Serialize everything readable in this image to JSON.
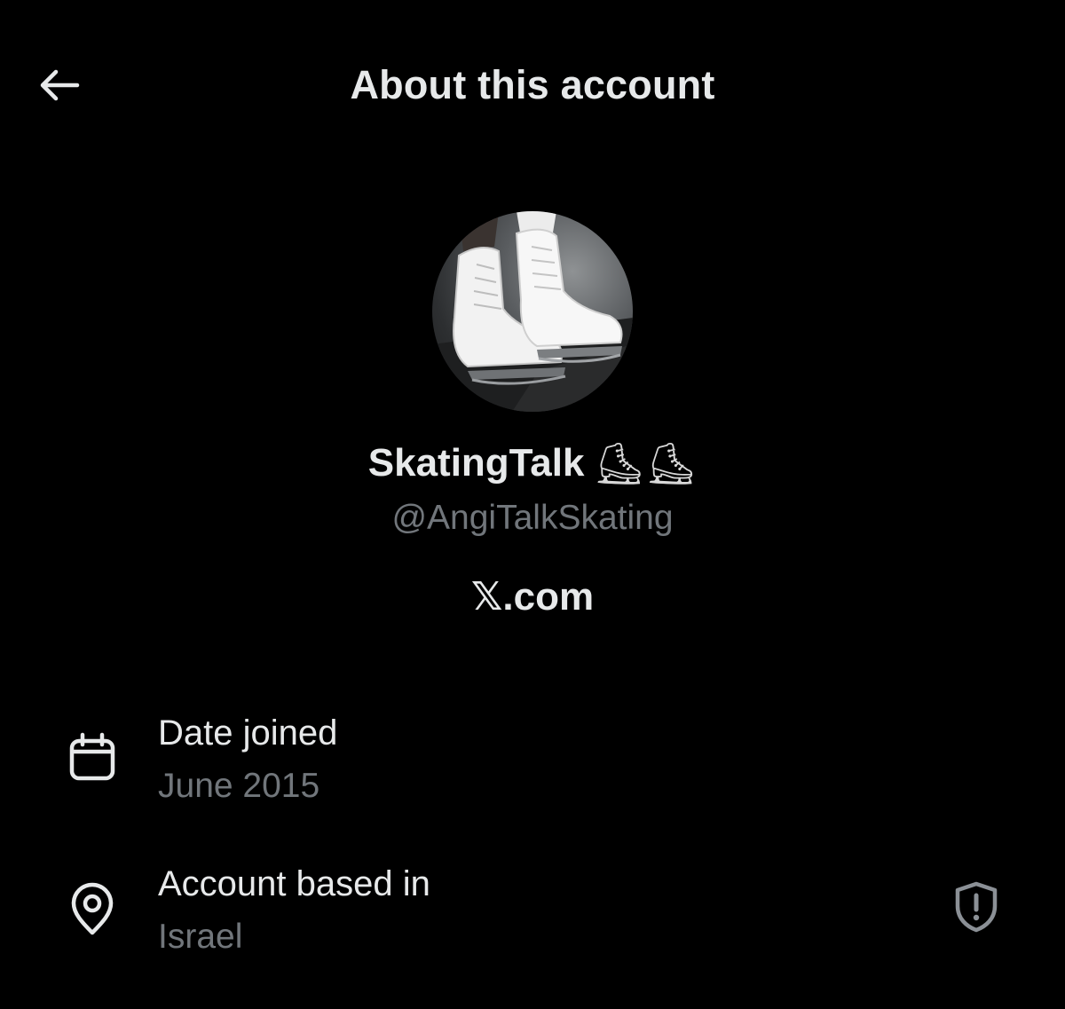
{
  "header": {
    "title": "About this account",
    "back_icon": "arrow-left-icon"
  },
  "profile": {
    "display_name": "SkatingTalk",
    "name_emoji": "⛸⛸",
    "handle": "@AngiTalkSkating",
    "source": "𝕏.com",
    "avatar_description_icon": "ice-skates-avatar"
  },
  "details": {
    "date_joined": {
      "icon": "calendar-icon",
      "label": "Date joined",
      "value": "June 2015"
    },
    "location": {
      "icon": "location-pin-icon",
      "label": "Account based in",
      "value": "Israel",
      "action_icon": "shield-alert-icon"
    }
  },
  "colors": {
    "background": "#000000",
    "primary_text": "#e7e9ea",
    "secondary_text": "#71767b"
  }
}
